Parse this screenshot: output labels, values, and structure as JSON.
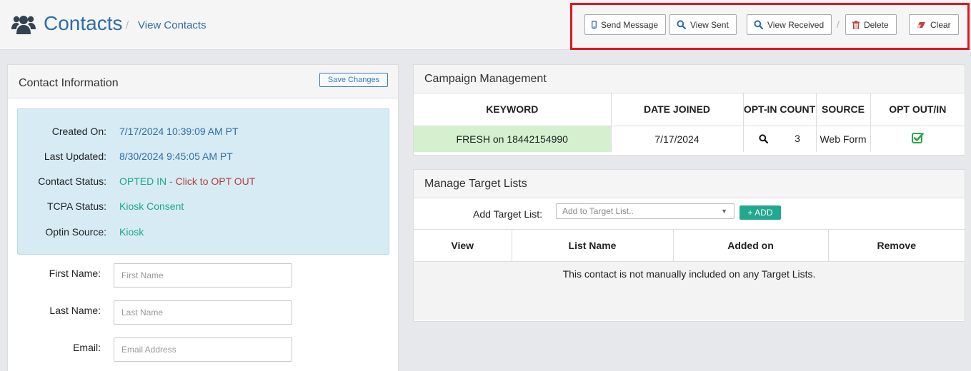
{
  "header": {
    "title": "Contacts",
    "breadcrumb_sep": "/",
    "breadcrumb": "View Contacts",
    "actions": {
      "send_message": "Send Message",
      "view_sent": "View Sent",
      "view_received": "View Received",
      "separator": "/",
      "delete": "Delete",
      "clear": "Clear"
    }
  },
  "contact_panel": {
    "title": "Contact Information",
    "save_label": "Save Changes",
    "info": [
      {
        "label": "Created On:",
        "value": "7/17/2024 10:39:09 AM PT"
      },
      {
        "label": "Last Updated:",
        "value": "8/30/2024 9:45:05 AM PT"
      },
      {
        "label": "Contact Status:",
        "value": "OPTED IN",
        "sep": " - ",
        "link": "Click to OPT OUT"
      },
      {
        "label": "TCPA Status:",
        "value": "Kiosk Consent"
      },
      {
        "label": "Optin Source:",
        "value": "Kiosk"
      }
    ],
    "fields": [
      {
        "label": "First Name:",
        "placeholder": "First Name",
        "value": ""
      },
      {
        "label": "Last Name:",
        "placeholder": "Last Name",
        "value": ""
      },
      {
        "label": "Email:",
        "placeholder": "Email Address",
        "value": ""
      }
    ]
  },
  "campaign": {
    "title": "Campaign Management",
    "columns": [
      "KEYWORD",
      "DATE JOINED",
      "OPT-IN COUNT",
      "SOURCE",
      "OPT OUT/IN"
    ],
    "rows": [
      {
        "keyword": "FRESH on 18442154990",
        "date_joined": "7/17/2024",
        "optin_count": "3",
        "source": "Web Form",
        "opt_status": "checked"
      }
    ]
  },
  "target_lists": {
    "title": "Manage Target Lists",
    "add_label": "Add Target List:",
    "select_placeholder": "Add to Target List..",
    "add_button": "+ ADD",
    "columns": [
      "View",
      "List Name",
      "Added on",
      "Remove"
    ],
    "empty_message": "This contact is not manually included on any Target Lists."
  },
  "colors": {
    "brand_blue": "#2f6ea5",
    "highlight_red": "#e0161f",
    "info_bg": "#d6ebf4",
    "keyword_bg": "#d4f0cf",
    "add_green": "#22a88e",
    "check_green": "#2aa54a"
  }
}
